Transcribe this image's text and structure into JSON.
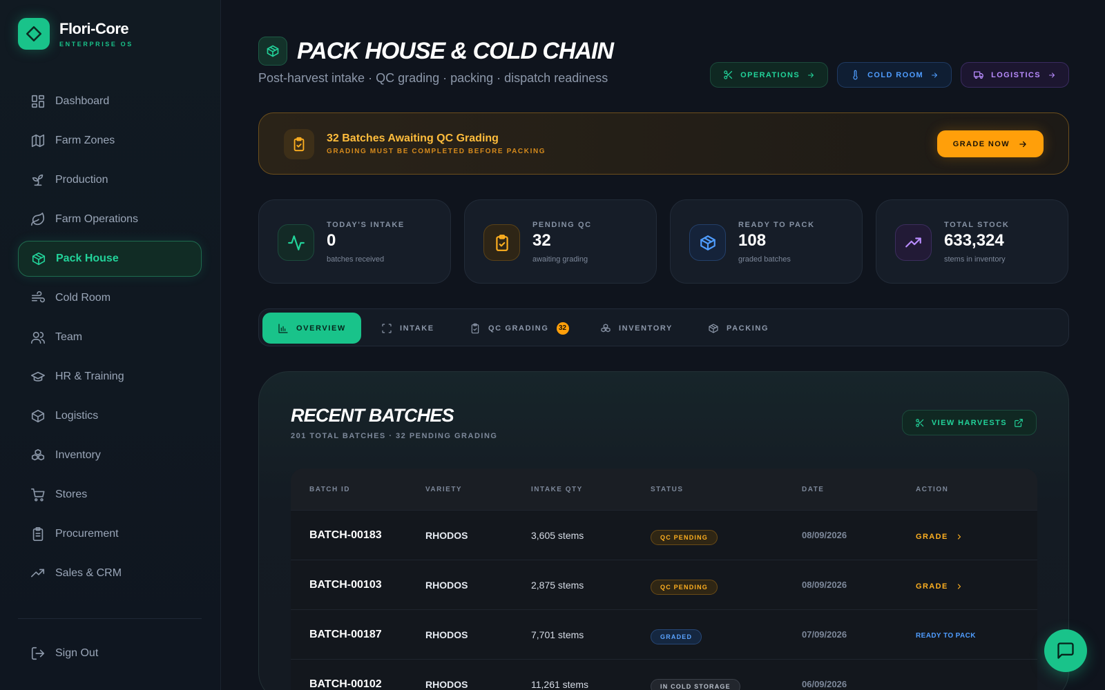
{
  "brand": {
    "name": "Flori-Core",
    "subtitle": "ENTERPRISE OS"
  },
  "sidebar": {
    "items": [
      {
        "label": "Dashboard",
        "icon": "dashboard-grid-icon"
      },
      {
        "label": "Farm Zones",
        "icon": "map-icon"
      },
      {
        "label": "Production",
        "icon": "sprout-icon"
      },
      {
        "label": "Farm Operations",
        "icon": "leaf-icon"
      },
      {
        "label": "Pack House",
        "icon": "package-icon",
        "active": true
      },
      {
        "label": "Cold Room",
        "icon": "wind-icon"
      },
      {
        "label": "Team",
        "icon": "users-icon"
      },
      {
        "label": "HR & Training",
        "icon": "graduation-cap-icon"
      },
      {
        "label": "Logistics",
        "icon": "box-icon"
      },
      {
        "label": "Inventory",
        "icon": "boxes-icon"
      },
      {
        "label": "Stores",
        "icon": "cart-icon"
      },
      {
        "label": "Procurement",
        "icon": "clipboard-icon"
      },
      {
        "label": "Sales & CRM",
        "icon": "trending-up-icon"
      }
    ],
    "signout_label": "Sign Out"
  },
  "header": {
    "title": "PACK HOUSE & COLD CHAIN",
    "subtitle": "Post-harvest intake · QC grading · packing · dispatch readiness",
    "quick_links": [
      {
        "label": "OPERATIONS",
        "icon": "scissors-icon"
      },
      {
        "label": "COLD ROOM",
        "icon": "thermometer-icon"
      },
      {
        "label": "LOGISTICS",
        "icon": "truck-icon"
      }
    ]
  },
  "alert": {
    "title": "32 Batches Awaiting QC Grading",
    "subtitle": "GRADING MUST BE COMPLETED BEFORE PACKING",
    "button_label": "GRADE NOW"
  },
  "stats": [
    {
      "label": "TODAY'S INTAKE",
      "value": "0",
      "note": "batches received",
      "icon": "activity-icon"
    },
    {
      "label": "PENDING QC",
      "value": "32",
      "note": "awaiting grading",
      "icon": "clipboard-check-icon"
    },
    {
      "label": "READY TO PACK",
      "value": "108",
      "note": "graded batches",
      "icon": "package-icon"
    },
    {
      "label": "TOTAL STOCK",
      "value": "633,324",
      "note": "stems in inventory",
      "icon": "trending-up-icon"
    }
  ],
  "tabs": [
    {
      "label": "OVERVIEW",
      "active": true
    },
    {
      "label": "INTAKE"
    },
    {
      "label": "QC GRADING",
      "badge": "32"
    },
    {
      "label": "INVENTORY"
    },
    {
      "label": "PACKING"
    }
  ],
  "batches": {
    "title": "RECENT BATCHES",
    "subtitle": "201 TOTAL BATCHES · 32 PENDING GRADING",
    "view_button": "VIEW HARVESTS",
    "columns": [
      "BATCH ID",
      "VARIETY",
      "INTAKE QTY",
      "STATUS",
      "DATE",
      "ACTION"
    ],
    "rows": [
      {
        "id": "BATCH-00183",
        "variety": "RHODOS",
        "qty": "3,605 stems",
        "status": "QC PENDING",
        "date": "08/09/2026",
        "action": "GRADE"
      },
      {
        "id": "BATCH-00103",
        "variety": "RHODOS",
        "qty": "2,875 stems",
        "status": "QC PENDING",
        "date": "08/09/2026",
        "action": "GRADE"
      },
      {
        "id": "BATCH-00187",
        "variety": "RHODOS",
        "qty": "7,701 stems",
        "status": "GRADED",
        "date": "07/09/2026",
        "action": "READY TO PACK"
      },
      {
        "id": "BATCH-00102",
        "variety": "RHODOS",
        "qty": "11,261 stems",
        "status": "IN COLD STORAGE",
        "date": "06/09/2026",
        "action": ""
      }
    ]
  },
  "colors": {
    "accent": "#19c38a",
    "warning": "#ff9f0a",
    "info": "#4f9dff",
    "purple": "#b98cff",
    "background": "#0f141d"
  }
}
